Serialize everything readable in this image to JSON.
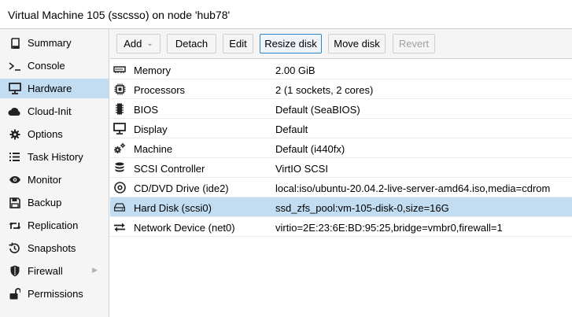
{
  "window": {
    "title": "Virtual Machine 105 (sscsso) on node 'hub78'"
  },
  "sidebar": {
    "items": [
      {
        "label": "Summary",
        "icon": "book-icon"
      },
      {
        "label": "Console",
        "icon": "terminal-icon"
      },
      {
        "label": "Hardware",
        "icon": "monitor-icon",
        "active": true
      },
      {
        "label": "Cloud-Init",
        "icon": "cloud-icon"
      },
      {
        "label": "Options",
        "icon": "gear-icon"
      },
      {
        "label": "Task History",
        "icon": "list-icon"
      },
      {
        "label": "Monitor",
        "icon": "eye-icon"
      },
      {
        "label": "Backup",
        "icon": "floppy-icon"
      },
      {
        "label": "Replication",
        "icon": "retweet-icon"
      },
      {
        "label": "Snapshots",
        "icon": "history-icon"
      },
      {
        "label": "Firewall",
        "icon": "shield-icon",
        "has_submenu": true
      },
      {
        "label": "Permissions",
        "icon": "unlock-icon"
      }
    ]
  },
  "toolbar": {
    "add": "Add",
    "detach": "Detach",
    "edit": "Edit",
    "resize": "Resize disk",
    "move": "Move disk",
    "revert": "Revert"
  },
  "hardware": {
    "rows": [
      {
        "name": "Memory",
        "value": "2.00 GiB",
        "icon": "memory-icon"
      },
      {
        "name": "Processors",
        "value": "2 (1 sockets, 2 cores)",
        "icon": "cpu-icon"
      },
      {
        "name": "BIOS",
        "value": "Default (SeaBIOS)",
        "icon": "microchip-icon"
      },
      {
        "name": "Display",
        "value": "Default",
        "icon": "desktop-icon"
      },
      {
        "name": "Machine",
        "value": "Default (i440fx)",
        "icon": "cogs-icon"
      },
      {
        "name": "SCSI Controller",
        "value": "VirtIO SCSI",
        "icon": "database-icon"
      },
      {
        "name": "CD/DVD Drive (ide2)",
        "value": "local:iso/ubuntu-20.04.2-live-server-amd64.iso,media=cdrom",
        "icon": "cdrom-icon"
      },
      {
        "name": "Hard Disk (scsi0)",
        "value": "ssd_zfs_pool:vm-105-disk-0,size=16G",
        "icon": "hdd-icon",
        "selected": true
      },
      {
        "name": "Network Device (net0)",
        "value": "virtio=2E:23:6E:BD:95:25,bridge=vmbr0,firewall=1",
        "icon": "exchange-icon"
      }
    ]
  },
  "colors": {
    "selection": "#c2ddf2",
    "panel_background": "#f5f5f5",
    "border": "#cfcfcf",
    "focus_border": "#2f85c8",
    "disabled_text": "#a0a0a0"
  }
}
